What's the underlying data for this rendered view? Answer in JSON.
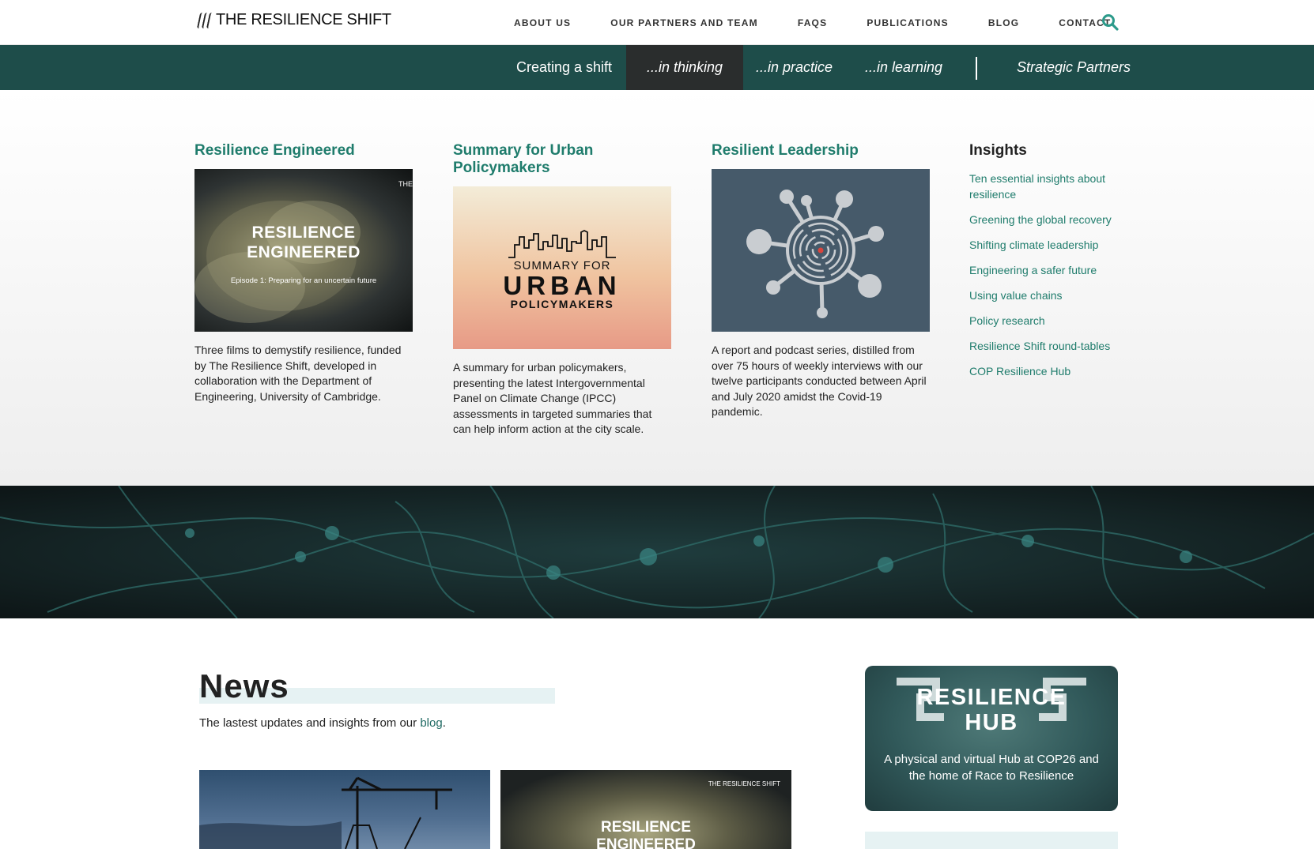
{
  "header": {
    "logo_text": "THE RESILIENCE SHIFT",
    "nav": [
      "ABOUT US",
      "OUR PARTNERS AND TEAM",
      "FAQS",
      "PUBLICATIONS",
      "BLOG",
      "CONTACT"
    ],
    "search_icon": "search-icon"
  },
  "subnav": {
    "items": [
      "Creating a shift",
      "...in thinking",
      "...in practice",
      "...in learning",
      "Strategic Partners"
    ],
    "active": "...in thinking"
  },
  "menu": {
    "columns": [
      {
        "title": "Resilience Engineered",
        "image": {
          "brand": "THE",
          "title_line1": "RESILIENCE",
          "title_line2": "ENGINEERED",
          "subtitle": "Episode 1: Preparing for an uncertain future"
        },
        "desc": "Three films to demystify resilience, funded by The Resilience Shift, developed in collaboration with the Department of Engineering, University of Cambridge."
      },
      {
        "title": "Summary for Urban Policymakers",
        "image": {
          "line1": "SUMMARY FOR",
          "line2": "URBAN",
          "line3": "POLICYMAKERS"
        },
        "desc": "A summary for urban policymakers, presenting the latest Intergovernmental Panel on Climate Change (IPCC) assessments in targeted summaries that can help inform action at the city scale."
      },
      {
        "title": "Resilient Leadership",
        "desc": "A report and podcast series, distilled from over 75 hours of weekly interviews with our twelve participants conducted between April and July 2020 amidst the Covid-19 pandemic."
      }
    ],
    "insights": {
      "title": "Insights",
      "links": [
        "Ten essential insights about resilience",
        "Greening the global recovery",
        "Shifting climate leadership",
        "Engineering a safer future",
        "Using value chains",
        "Policy research",
        "Resilience Shift round-tables",
        "COP Resilience Hub"
      ]
    }
  },
  "news": {
    "title": "News",
    "subtitle_prefix": "The lastest updates and insights from our ",
    "subtitle_link": "blog",
    "subtitle_suffix": ".",
    "card2": {
      "brand": "THE RESILIENCE SHIFT",
      "line1": "RESILIENCE",
      "line2": "ENGINEERED"
    }
  },
  "hub": {
    "line1": "RESILIENCE",
    "line2": "HUB",
    "desc": "A physical and virtual Hub at COP26 and the home of Race to Resilience"
  },
  "colors": {
    "teal_dark": "#1e4d4a",
    "teal_link": "#1f7c6c",
    "active_tab": "#2a2d2d"
  }
}
